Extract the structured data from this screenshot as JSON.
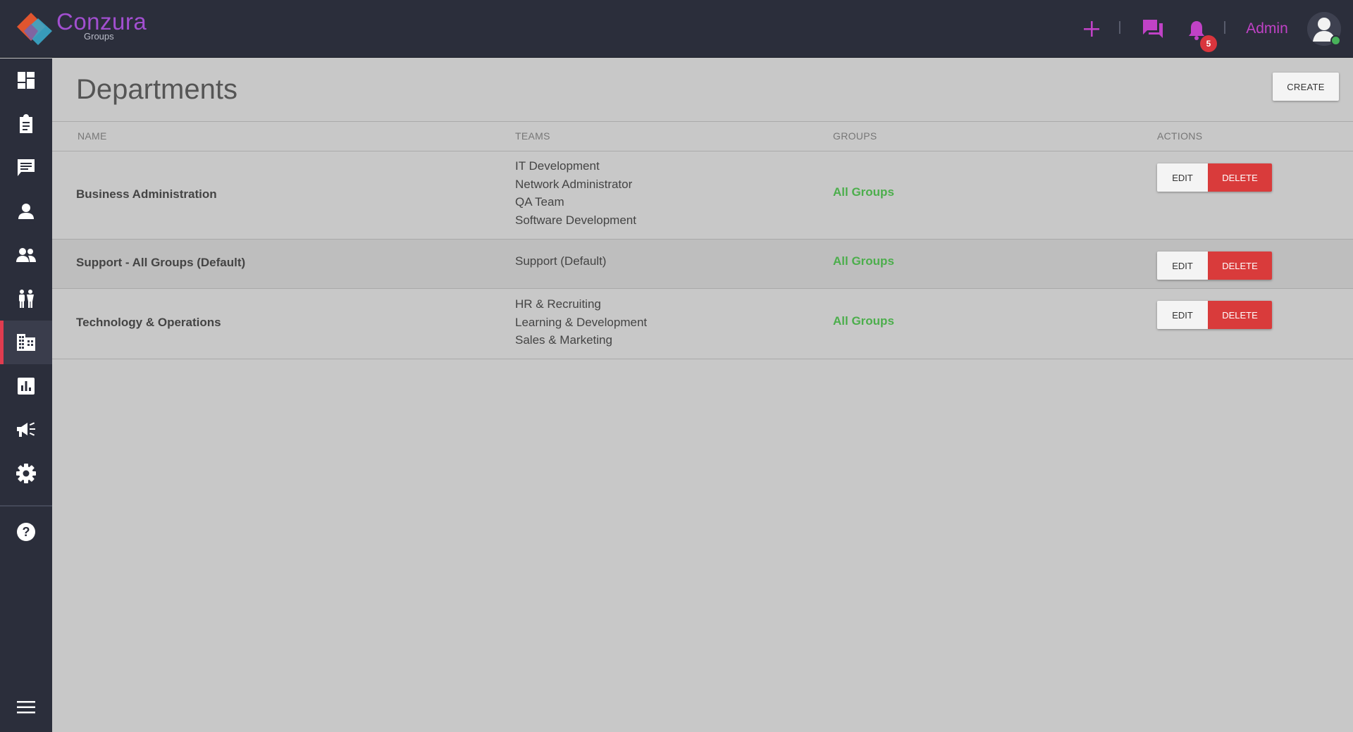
{
  "app": {
    "name": "Conzura",
    "sub": "Groups"
  },
  "header": {
    "notification_count": "5",
    "user_label": "Admin",
    "accent_color": "#c042c6"
  },
  "sidebar": {
    "items": [
      {
        "icon": "dashboard-icon"
      },
      {
        "icon": "clipboard-icon"
      },
      {
        "icon": "chat-icon"
      },
      {
        "icon": "user-icon"
      },
      {
        "icon": "users-icon"
      },
      {
        "icon": "people-icon"
      },
      {
        "icon": "building-icon",
        "active": true
      },
      {
        "icon": "chart-icon"
      },
      {
        "icon": "megaphone-icon"
      },
      {
        "icon": "gear-icon"
      },
      {
        "icon": "help-icon"
      },
      {
        "icon": "menu-icon"
      }
    ]
  },
  "page": {
    "title": "Departments",
    "create_label": "CREATE"
  },
  "table": {
    "columns": [
      "NAME",
      "TEAMS",
      "GROUPS",
      "ACTIONS"
    ],
    "edit_label": "EDIT",
    "delete_label": "DELETE",
    "rows": [
      {
        "name": "Business Administration",
        "teams": [
          "IT Development",
          "Network Administrator",
          "QA Team",
          "Software Development"
        ],
        "groups": "All Groups"
      },
      {
        "name": "Support - All Groups (Default)",
        "teams": [
          "Support (Default)"
        ],
        "groups": "All Groups"
      },
      {
        "name": "Technology & Operations",
        "teams": [
          "HR & Recruiting",
          "Learning & Development",
          "Sales & Marketing"
        ],
        "groups": "All Groups"
      }
    ]
  }
}
